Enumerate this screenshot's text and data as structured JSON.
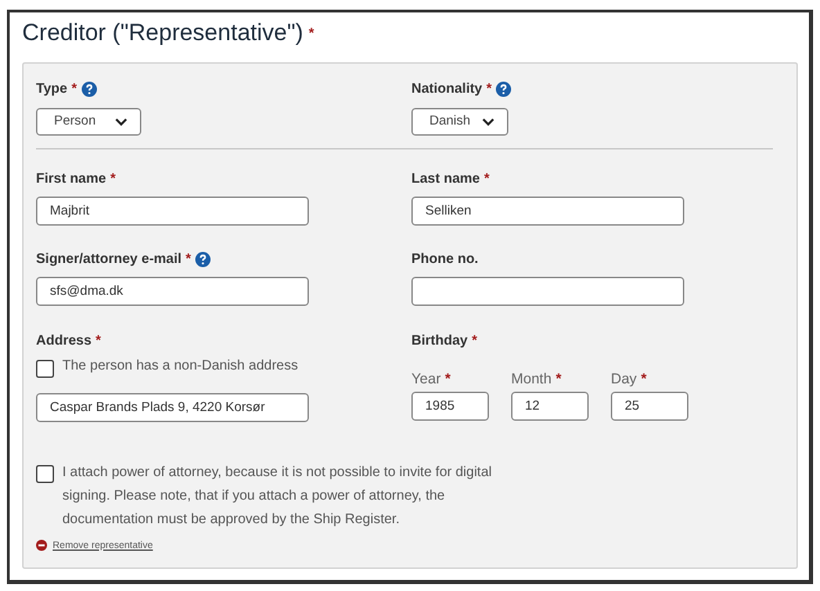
{
  "title": "Creditor (\"Representative\")",
  "title_required": true,
  "required_mark": "*",
  "rows": [
    [
      {
        "kind": "select",
        "label": "Type",
        "required": true,
        "help": true,
        "value": "Person"
      },
      {
        "kind": "select",
        "label": "Nationality",
        "required": true,
        "help": true,
        "value": "Danish"
      }
    ],
    [
      {
        "kind": "text",
        "label": "First name",
        "required": true,
        "help": false,
        "value": "Majbrit"
      },
      {
        "kind": "text",
        "label": "Last name",
        "required": true,
        "help": false,
        "value": "Selliken"
      }
    ],
    [
      {
        "kind": "text",
        "label": "Signer/attorney e-mail",
        "required": true,
        "help": true,
        "value": "sfs@dma.dk"
      },
      {
        "kind": "text",
        "label": "Phone no.",
        "required": false,
        "help": false
      }
    ],
    [
      {
        "kind": "address",
        "label": "Address",
        "required": true,
        "help": false,
        "checkbox": {
          "label": "The person has a non-Danish address",
          "checked": false
        },
        "value": "Caspar Brands Plads 9, 4220 Korsør"
      },
      {
        "kind": "date",
        "label": "Birthday",
        "required": true,
        "help": false,
        "parts": [
          {
            "label": "Year",
            "required": true,
            "value": "1985"
          },
          {
            "label": "Month",
            "required": true,
            "value": "12"
          },
          {
            "label": "Day",
            "required": true,
            "value": "25"
          }
        ]
      }
    ]
  ],
  "attorney": {
    "label": "I attach power of attorney, because it is not possible to invite for digital signing. Please note, that if you attach a power of attorney, the documentation must be approved by the Ship Register.",
    "checked": false
  },
  "remove_link": "Remove representative"
}
